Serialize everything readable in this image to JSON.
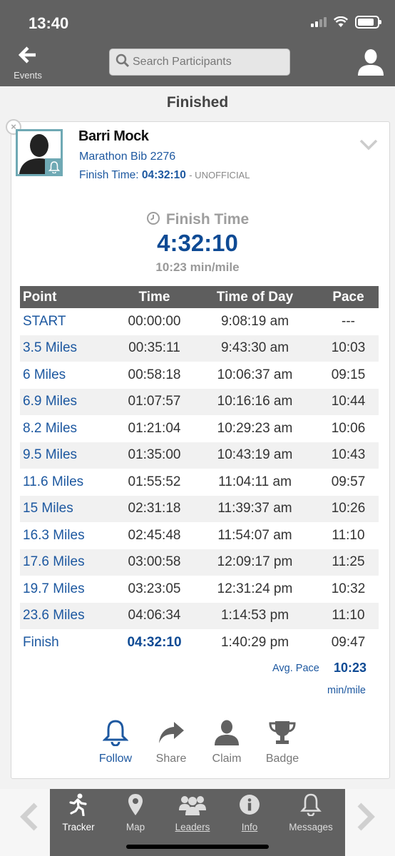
{
  "status_bar": {
    "time": "13:40"
  },
  "header": {
    "back_label": "Events",
    "search_placeholder": "Search Participants"
  },
  "section_title": "Finished",
  "participant": {
    "name": "Barri Mock",
    "bib": "Marathon Bib 2276",
    "finish_label": "Finish Time:",
    "finish_time": "04:32:10",
    "status": "- UNOFFICIAL"
  },
  "summary": {
    "label": "Finish Time",
    "time": "4:32:10",
    "pace": "10:23 min/mile"
  },
  "splits": {
    "headers": [
      "Point",
      "Time",
      "Time of Day",
      "Pace"
    ],
    "rows": [
      [
        "START",
        "00:00:00",
        "9:08:19 am",
        "---"
      ],
      [
        "3.5 Miles",
        "00:35:11",
        "9:43:30 am",
        "10:03"
      ],
      [
        "6 Miles",
        "00:58:18",
        "10:06:37 am",
        "09:15"
      ],
      [
        "6.9 Miles",
        "01:07:57",
        "10:16:16 am",
        "10:44"
      ],
      [
        "8.2 Miles",
        "01:21:04",
        "10:29:23 am",
        "10:06"
      ],
      [
        "9.5 Miles",
        "01:35:00",
        "10:43:19 am",
        "10:43"
      ],
      [
        "11.6 Miles",
        "01:55:52",
        "11:04:11 am",
        "09:57"
      ],
      [
        "15 Miles",
        "02:31:18",
        "11:39:37 am",
        "10:26"
      ],
      [
        "16.3 Miles",
        "02:45:48",
        "11:54:07 am",
        "11:10"
      ],
      [
        "17.6 Miles",
        "03:00:58",
        "12:09:17 pm",
        "11:25"
      ],
      [
        "19.7 Miles",
        "03:23:05",
        "12:31:24 pm",
        "10:32"
      ],
      [
        "23.6 Miles",
        "04:06:34",
        "1:14:53 pm",
        "11:10"
      ],
      [
        "Finish",
        "04:32:10",
        "1:40:29 pm",
        "09:47"
      ]
    ],
    "avg_pace_label": "Avg. Pace",
    "avg_pace_value": "10:23",
    "avg_pace_unit": "min/mile"
  },
  "actions": [
    {
      "label": "Follow",
      "icon": "bell-icon"
    },
    {
      "label": "Share",
      "icon": "share-arrow-icon"
    },
    {
      "label": "Claim",
      "icon": "person-icon"
    },
    {
      "label": "Badge",
      "icon": "trophy-icon"
    }
  ],
  "tabs": [
    {
      "label": "Tracker",
      "icon": "runner-icon"
    },
    {
      "label": "Map",
      "icon": "map-pin-icon"
    },
    {
      "label": "Leaders",
      "icon": "group-icon"
    },
    {
      "label": "Info",
      "icon": "info-icon"
    },
    {
      "label": "Messages",
      "icon": "bell-icon"
    }
  ],
  "colors": {
    "header_bg": "#616161",
    "link_blue": "#1d58a0",
    "accent_blue": "#0e4a94",
    "avatar_border": "#6fa9b4"
  }
}
